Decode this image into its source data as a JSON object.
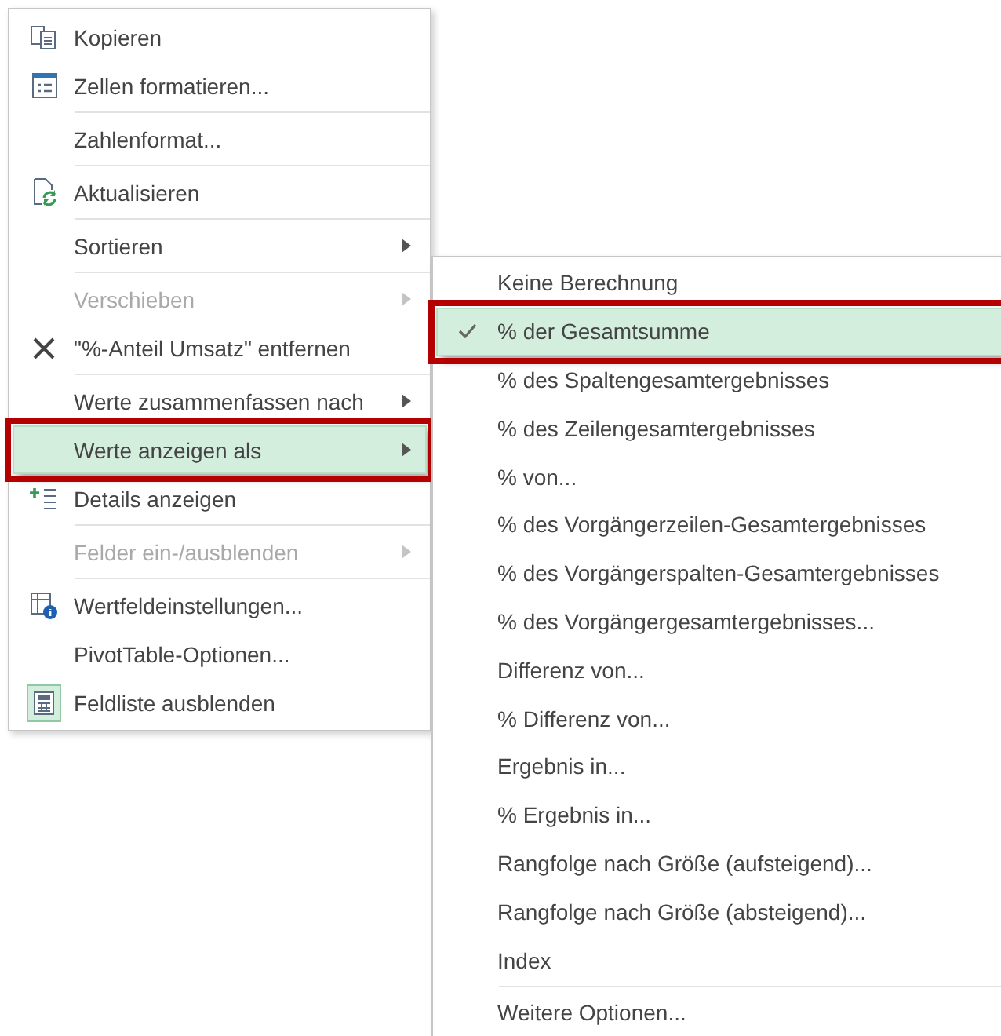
{
  "context_menu": {
    "groups": [
      [
        {
          "label": "Kopieren",
          "disabled": false,
          "selected": false,
          "marked": false,
          "checked": false,
          "has_submenu": false
        },
        {
          "label": "Zellen formatieren...",
          "disabled": false,
          "selected": false,
          "marked": false,
          "checked": false,
          "has_submenu": false
        }
      ],
      [
        {
          "label": "Zahlenformat...",
          "disabled": false,
          "selected": false,
          "marked": false,
          "checked": false,
          "has_submenu": false
        }
      ],
      [
        {
          "label": "Aktualisieren",
          "disabled": false,
          "selected": false,
          "marked": false,
          "checked": false,
          "has_submenu": false
        }
      ],
      [
        {
          "label": "Sortieren",
          "disabled": false,
          "selected": false,
          "marked": false,
          "checked": false,
          "has_submenu": true
        }
      ],
      [
        {
          "label": "Verschieben",
          "disabled": true,
          "selected": false,
          "marked": false,
          "checked": false,
          "has_submenu": true
        },
        {
          "label": "\"%-Anteil Umsatz\" entfernen",
          "disabled": false,
          "selected": false,
          "marked": false,
          "checked": false,
          "has_submenu": false
        }
      ],
      [
        {
          "label": "Werte zusammenfassen nach",
          "disabled": false,
          "selected": false,
          "marked": false,
          "checked": false,
          "has_submenu": true
        },
        {
          "label": "Werte anzeigen als",
          "disabled": false,
          "selected": true,
          "marked": true,
          "checked": false,
          "has_submenu": true
        },
        {
          "label": "Details anzeigen",
          "disabled": false,
          "selected": false,
          "marked": false,
          "checked": false,
          "has_submenu": false
        }
      ],
      [
        {
          "label": "Felder ein-/ausblenden",
          "disabled": true,
          "selected": false,
          "marked": false,
          "checked": false,
          "has_submenu": true
        }
      ],
      [
        {
          "label": "Wertfeldeinstellungen...",
          "disabled": false,
          "selected": false,
          "marked": false,
          "checked": false,
          "has_submenu": false
        },
        {
          "label": "PivotTable-Optionen...",
          "disabled": false,
          "selected": false,
          "marked": false,
          "checked": false,
          "has_submenu": false
        },
        {
          "label": "Feldliste ausblenden",
          "disabled": false,
          "selected": false,
          "marked": false,
          "checked": true,
          "has_submenu": false
        }
      ]
    ]
  },
  "submenu": {
    "groups": [
      [
        {
          "label": "Keine Berechnung",
          "checked": false,
          "selected": false,
          "marked": false
        },
        {
          "label": "% der Gesamtsumme",
          "checked": true,
          "selected": true,
          "marked": true
        },
        {
          "label": "% des Spaltengesamtergebnisses",
          "checked": false,
          "selected": false,
          "marked": false
        },
        {
          "label": "% des Zeilengesamtergebnisses",
          "checked": false,
          "selected": false,
          "marked": false
        },
        {
          "label": "% von...",
          "checked": false,
          "selected": false,
          "marked": false
        },
        {
          "label": "% des Vorgängerzeilen-Gesamtergebnisses",
          "checked": false,
          "selected": false,
          "marked": false
        },
        {
          "label": "% des Vorgängerspalten-Gesamtergebnisses",
          "checked": false,
          "selected": false,
          "marked": false
        },
        {
          "label": "% des Vorgängergesamtergebnisses...",
          "checked": false,
          "selected": false,
          "marked": false
        },
        {
          "label": "Differenz von...",
          "checked": false,
          "selected": false,
          "marked": false
        },
        {
          "label": "% Differenz von...",
          "checked": false,
          "selected": false,
          "marked": false
        },
        {
          "label": "Ergebnis in...",
          "checked": false,
          "selected": false,
          "marked": false
        },
        {
          "label": "% Ergebnis in...",
          "checked": false,
          "selected": false,
          "marked": false
        },
        {
          "label": "Rangfolge nach Größe (aufsteigend)...",
          "checked": false,
          "selected": false,
          "marked": false
        },
        {
          "label": "Rangfolge nach Größe (absteigend)...",
          "checked": false,
          "selected": false,
          "marked": false
        },
        {
          "label": "Index",
          "checked": false,
          "selected": false,
          "marked": false
        }
      ],
      [
        {
          "label": "Weitere Optionen...",
          "checked": false,
          "selected": false,
          "marked": false
        }
      ]
    ]
  }
}
